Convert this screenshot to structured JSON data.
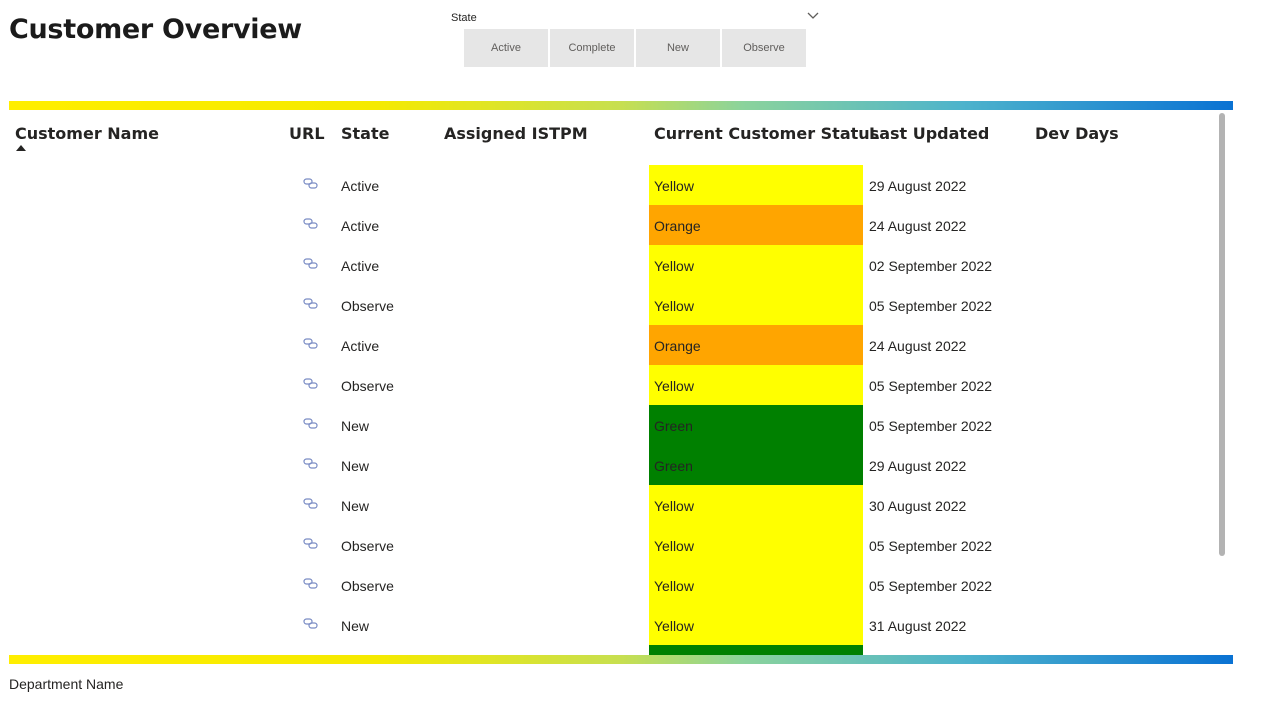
{
  "page": {
    "title": "Customer Overview",
    "footer": "Department Name"
  },
  "slicer": {
    "label": "State",
    "options": [
      "Active",
      "Complete",
      "New",
      "Observe"
    ]
  },
  "table": {
    "headers": {
      "customer_name": "Customer Name",
      "url": "URL",
      "state": "State",
      "assigned_istpm": "Assigned ISTPM",
      "current_status": "Current Customer Status",
      "last_updated": "Last Updated",
      "dev_days": "Dev Days"
    },
    "sort": {
      "column": "Customer Name",
      "direction": "ascending"
    },
    "status_colors": {
      "Yellow": "#ffff00",
      "Orange": "#ffa500",
      "Green": "#008000"
    },
    "rows": [
      {
        "state": "Active",
        "status": "Yellow",
        "last_updated": "29 August 2022"
      },
      {
        "state": "Active",
        "status": "Orange",
        "last_updated": "24 August 2022"
      },
      {
        "state": "Active",
        "status": "Yellow",
        "last_updated": "02 September 2022"
      },
      {
        "state": "Observe",
        "status": "Yellow",
        "last_updated": "05 September 2022"
      },
      {
        "state": "Active",
        "status": "Orange",
        "last_updated": "24 August 2022"
      },
      {
        "state": "Observe",
        "status": "Yellow",
        "last_updated": "05 September 2022"
      },
      {
        "state": "New",
        "status": "Green",
        "last_updated": "05 September 2022"
      },
      {
        "state": "New",
        "status": "Green",
        "last_updated": "29 August 2022"
      },
      {
        "state": "New",
        "status": "Yellow",
        "last_updated": "30 August 2022"
      },
      {
        "state": "Observe",
        "status": "Yellow",
        "last_updated": "05 September 2022"
      },
      {
        "state": "Observe",
        "status": "Yellow",
        "last_updated": "05 September 2022"
      },
      {
        "state": "New",
        "status": "Yellow",
        "last_updated": "31 August 2022"
      },
      {
        "state": "",
        "status": "Green",
        "last_updated": ""
      }
    ]
  },
  "icons": {
    "link": "link-icon",
    "dropdown": "chevron-down-icon",
    "sort": "sort-ascending-icon"
  },
  "colors": {
    "gradient_start": "#ffee00",
    "gradient_end": "#0a72d3"
  }
}
